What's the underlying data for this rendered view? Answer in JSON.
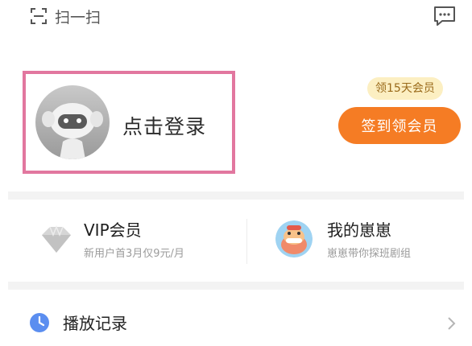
{
  "topbar": {
    "scan_label": "扫一扫",
    "scan_icon": "scan-icon",
    "message_icon": "message-icon"
  },
  "login": {
    "prompt": "点击登录",
    "avatar_icon": "robot-avatar",
    "highlight_color": "#e2779f"
  },
  "vip_promo": {
    "badge": "领15天会员",
    "signin_label": "签到领会员",
    "accent": "#f57c24"
  },
  "vip": {
    "title": "VIP会员",
    "subtitle": "新用户首3月仅9元/月",
    "icon": "diamond-icon"
  },
  "huihui": {
    "title": "我的崽崽",
    "subtitle": "崽崽带你探班剧组",
    "icon": "cartoon-avatar"
  },
  "menu": {
    "history_label": "播放记录",
    "history_icon": "clock-icon",
    "chevron": "chevron-right-icon"
  }
}
